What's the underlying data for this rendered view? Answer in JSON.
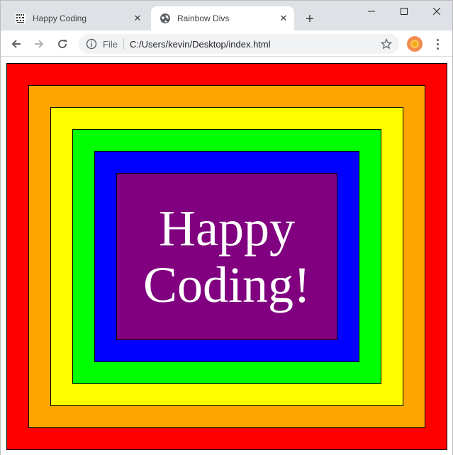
{
  "browser": {
    "tabs": [
      {
        "title": "Happy Coding",
        "favicon": "happy-coding-logo-icon",
        "active": false
      },
      {
        "title": "Rainbow Divs",
        "favicon": "globe-icon",
        "active": true
      }
    ],
    "new_tab": "+",
    "address": {
      "scheme_label": "File",
      "url": "C:/Users/kevin/Desktop/index.html"
    }
  },
  "page": {
    "text_line1": "Happy",
    "text_line2": "Coding!"
  },
  "colors": {
    "red": "#ff0000",
    "orange": "#ffa500",
    "yellow": "#ffff00",
    "green": "#00ff00",
    "blue": "#0000ff",
    "purple": "#800080",
    "text": "#ffffff"
  }
}
